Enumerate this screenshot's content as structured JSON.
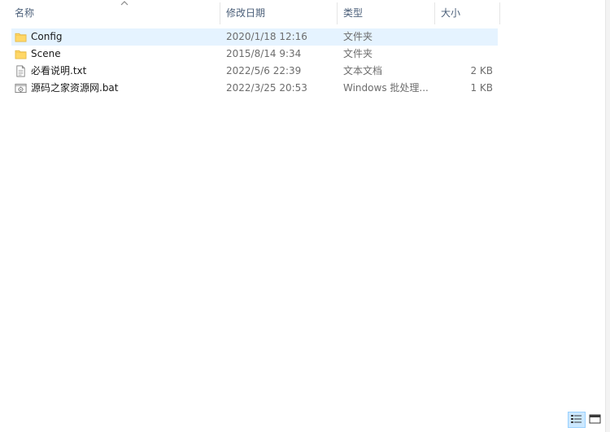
{
  "columns": {
    "name": "名称",
    "date": "修改日期",
    "type": "类型",
    "size": "大小"
  },
  "files": [
    {
      "name": "Config",
      "date": "2020/1/18 12:16",
      "type": "文件夹",
      "size": "",
      "icon": "folder-icon",
      "selected": true
    },
    {
      "name": "Scene",
      "date": "2015/8/14 9:34",
      "type": "文件夹",
      "size": "",
      "icon": "folder-icon",
      "selected": false
    },
    {
      "name": "必看说明.txt",
      "date": "2022/5/6 22:39",
      "type": "文本文档",
      "size": "2 KB",
      "icon": "text-file-icon",
      "selected": false
    },
    {
      "name": "源码之家资源网.bat",
      "date": "2022/3/25 20:53",
      "type": "Windows 批处理...",
      "size": "1 KB",
      "icon": "batch-file-icon",
      "selected": false
    }
  ],
  "view_buttons": {
    "details": {
      "icon": "details-view-icon",
      "active": true
    },
    "large_icons": {
      "icon": "large-icons-view-icon",
      "active": false
    }
  },
  "colors": {
    "selection": "#e5f3ff",
    "header_text": "#4c607a",
    "folder": "#ffd767"
  }
}
